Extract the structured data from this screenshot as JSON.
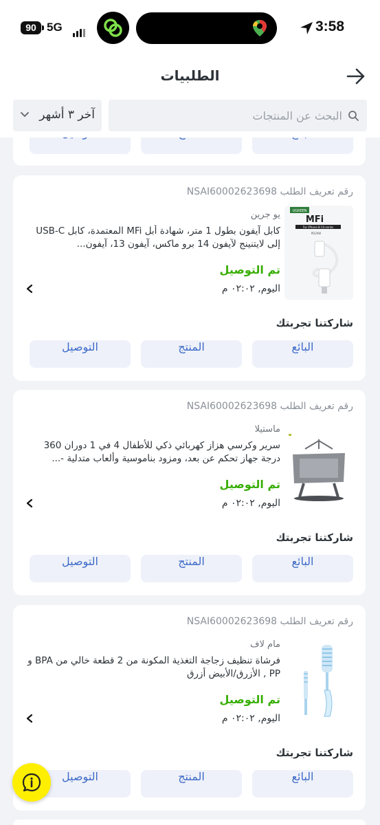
{
  "status_bar": {
    "battery": "90",
    "network": "5G",
    "time": "3:58"
  },
  "header": {
    "title": "الطلبيات",
    "search_placeholder": "البحث عن المنتجات",
    "filter_label": "آخر ٣ أشهر"
  },
  "feedback_labels": {
    "seller": "البائع",
    "product": "المنتج",
    "delivery": "التوصيل"
  },
  "orders": [
    {
      "order_id": "رقم تعريف الطلب NSAI60002623698",
      "brand": "يو جرين",
      "name": "كابل آيفون بطول 1 متر، شهادة أبل MFi المعتمدة، كابل USB-C إلى لايتنينج لآيفون 14 برو ماكس، آيفون 13، آيفون...",
      "status": "تم التوصيل",
      "time": "اليوم, ٠٢:٠٢ م",
      "share_label": "شاركتنا تجربتك"
    },
    {
      "order_id": "رقم تعريف الطلب NSAI60002623698",
      "brand": "ماستيلا",
      "name": "سرير وكرسي هزاز كهربائي ذكي للأطفال 4 في 1 دوران 360 درجة جهاز تحكم عن بعد، ومزود بناموسية وألعاب متدلية -...",
      "status": "تم التوصيل",
      "time": "اليوم, ٠٢:٠٢ م",
      "share_label": "شاركتنا تجربتك"
    },
    {
      "order_id": "رقم تعريف الطلب NSAI60002623698",
      "brand": "مام لاف",
      "name": "فرشاة تنظيف زجاجة التغذية المكونة من 2 قطعة  خالي من BPA و PP , الأزرق/الأبيض أزرق",
      "status": "تم التوصيل",
      "time": "اليوم, ٠٢:٠٢ م",
      "share_label": "شاركتنا تجربتك"
    }
  ],
  "thumb_text": {
    "brand": "UGREEN",
    "mfi": "MFi",
    "series": "For iPhone 8-14 series",
    "power": "PD20W"
  },
  "colors": {
    "accent_blue": "#3c6ac8",
    "delivered_green": "#38ae04",
    "fab_yellow": "#feee00"
  }
}
